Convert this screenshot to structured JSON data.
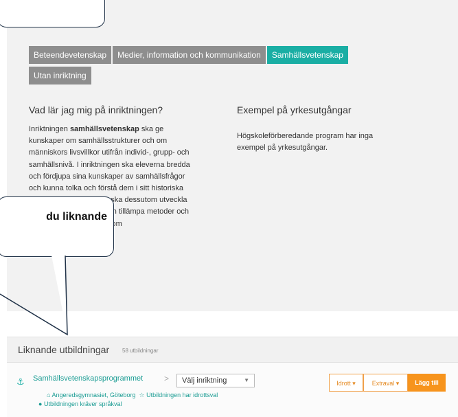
{
  "tabs": [
    "Beteendevetenskap",
    "Medier, information och kommunikation",
    "Samhällsvetenskap",
    "Utan inriktning"
  ],
  "learn": {
    "title": "Vad lär jag mig på inriktningen?",
    "text_pre": "Inriktningen ",
    "text_bold": "samhällsvetenskap",
    "text_post": " ska ge kunskaper om samhällsstrukturer och om människors livsvillkor utifrån individ-, grupp- och samhällsnivå. I inriktningen ska eleverna bredda och fördjupa sina kunskaper av samhällsfrågor och kunna tolka och förstå dem i sitt historiska sammanhang. Eleverna ska dessutom utveckla förmågan att använda och tillämpa metoder och begrepp som används inom samhällsvetenskapen."
  },
  "careers": {
    "title": "Exempel på yrkesutgångar",
    "text": "Högskoleförberedande program har inga exempel på yrkesutgångar."
  },
  "callout_text": "du liknande",
  "similar": {
    "title": "Liknande utbildningar",
    "count": "58 utbildningar",
    "program": "Samhällsvetenskapsprogrammet",
    "separator": ">",
    "select_value": "Välj inriktning",
    "school": "Angeredsgymnasiet, Göteborg",
    "sport": "Utbildningen har idrottsval",
    "language": "Utbildningen kräver språkval",
    "btn_idrott": "Idrott",
    "btn_extraval": "Extraval",
    "btn_add": "Lägg till"
  }
}
